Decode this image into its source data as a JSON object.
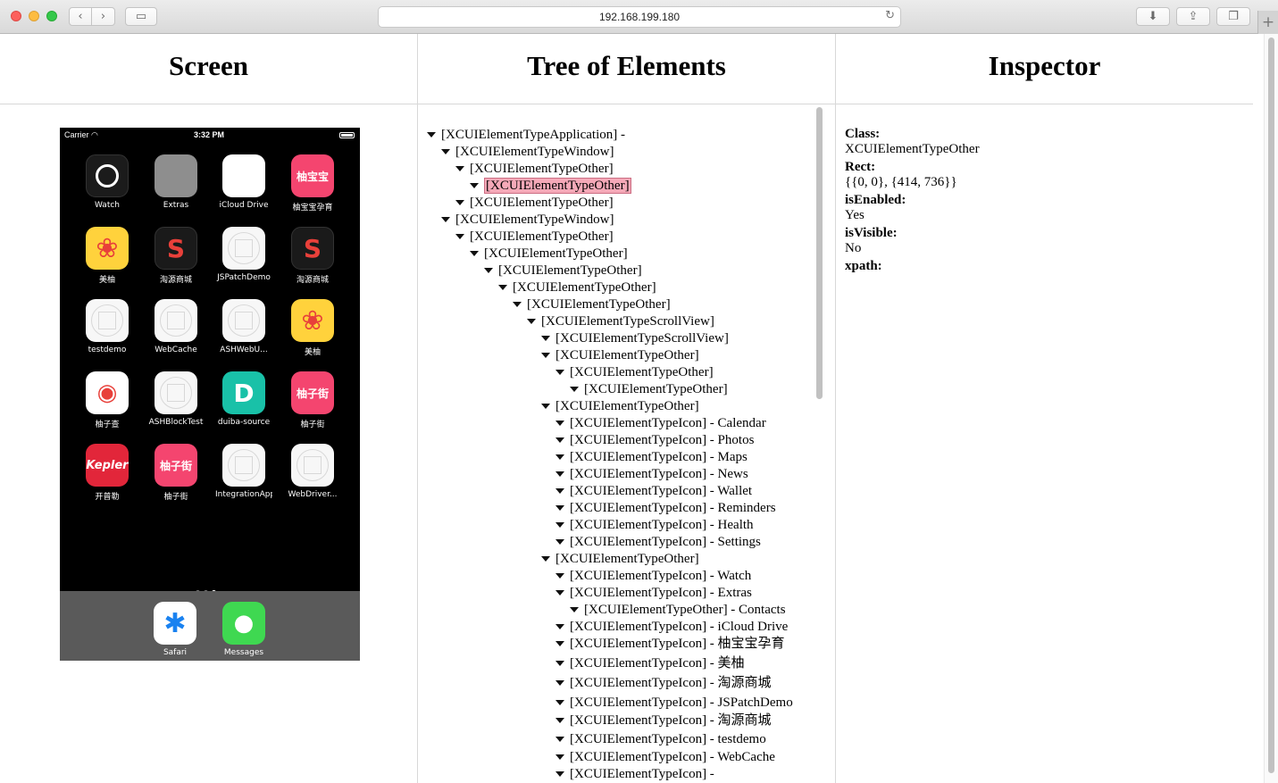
{
  "browser": {
    "url": "192.168.199.180",
    "back_icon": "chevron-left",
    "forward_icon": "chevron-right",
    "sidebar_icon": "sidebar",
    "reload_icon": "reload",
    "download_icon": "download",
    "share_icon": "share",
    "tabs_icon": "tabs",
    "new_tab_label": "+"
  },
  "columns": {
    "screen_title": "Screen",
    "tree_title": "Tree of Elements",
    "inspector_title": "Inspector"
  },
  "phone": {
    "carrier": "Carrier",
    "time": "3:32 PM",
    "page_dots": 3,
    "active_page": 3,
    "apps": [
      {
        "label": "Watch",
        "icon": "watch-icon"
      },
      {
        "label": "Extras",
        "icon": "folder-icon"
      },
      {
        "label": "iCloud Drive",
        "icon": "cloud-icon"
      },
      {
        "label": "柚宝宝孕育",
        "icon": "baby-icon",
        "glyph": "柚宝宝"
      },
      {
        "label": "美柚",
        "icon": "citrus-icon",
        "glyph": "❀"
      },
      {
        "label": "淘源商城",
        "icon": "taoyuan-icon",
        "glyph": "S"
      },
      {
        "label": "JSPatchDemo",
        "icon": "placeholder-icon"
      },
      {
        "label": "淘源商城",
        "icon": "taoyuan-icon",
        "glyph": "S"
      },
      {
        "label": "testdemo",
        "icon": "placeholder-icon"
      },
      {
        "label": "WebCache",
        "icon": "placeholder-icon"
      },
      {
        "label": "ASHWebU...",
        "icon": "placeholder-icon"
      },
      {
        "label": "美柚",
        "icon": "citrus-icon",
        "glyph": "❀"
      },
      {
        "label": "柚子查",
        "icon": "eye-icon",
        "glyph": "◉"
      },
      {
        "label": "ASHBlockTest",
        "icon": "placeholder-icon"
      },
      {
        "label": "duiba-source",
        "icon": "duiba-icon",
        "glyph": "D"
      },
      {
        "label": "柚子街",
        "icon": "youzijie-icon",
        "glyph": "柚子街"
      },
      {
        "label": "开普勒",
        "icon": "kepler-icon",
        "glyph": "Kepler"
      },
      {
        "label": "柚子街",
        "icon": "youzijie-icon",
        "glyph": "柚子街"
      },
      {
        "label": "IntegrationApp",
        "icon": "placeholder-icon"
      },
      {
        "label": "WebDriver...",
        "icon": "placeholder-icon"
      }
    ],
    "dock": [
      {
        "label": "Safari",
        "icon": "compass-icon",
        "glyph": "✱"
      },
      {
        "label": "Messages",
        "icon": "speech-bubble-icon",
        "glyph": "●"
      }
    ]
  },
  "tree": [
    {
      "depth": 0,
      "text": "[XCUIElementTypeApplication] -"
    },
    {
      "depth": 1,
      "text": "[XCUIElementTypeWindow]"
    },
    {
      "depth": 2,
      "text": "[XCUIElementTypeOther]"
    },
    {
      "depth": 3,
      "text": "[XCUIElementTypeOther]",
      "selected": true
    },
    {
      "depth": 2,
      "text": "[XCUIElementTypeOther]"
    },
    {
      "depth": 1,
      "text": "[XCUIElementTypeWindow]"
    },
    {
      "depth": 2,
      "text": "[XCUIElementTypeOther]"
    },
    {
      "depth": 3,
      "text": "[XCUIElementTypeOther]"
    },
    {
      "depth": 4,
      "text": "[XCUIElementTypeOther]"
    },
    {
      "depth": 5,
      "text": "[XCUIElementTypeOther]"
    },
    {
      "depth": 6,
      "text": "[XCUIElementTypeOther]"
    },
    {
      "depth": 7,
      "text": "[XCUIElementTypeScrollView]"
    },
    {
      "depth": 8,
      "text": "[XCUIElementTypeScrollView]"
    },
    {
      "depth": 8,
      "text": "[XCUIElementTypeOther]"
    },
    {
      "depth": 9,
      "text": "[XCUIElementTypeOther]"
    },
    {
      "depth": 10,
      "text": "[XCUIElementTypeOther]"
    },
    {
      "depth": 8,
      "text": "[XCUIElementTypeOther]"
    },
    {
      "depth": 9,
      "text": "[XCUIElementTypeIcon] - Calendar"
    },
    {
      "depth": 9,
      "text": "[XCUIElementTypeIcon] - Photos"
    },
    {
      "depth": 9,
      "text": "[XCUIElementTypeIcon] - Maps"
    },
    {
      "depth": 9,
      "text": "[XCUIElementTypeIcon] - News"
    },
    {
      "depth": 9,
      "text": "[XCUIElementTypeIcon] - Wallet"
    },
    {
      "depth": 9,
      "text": "[XCUIElementTypeIcon] - Reminders"
    },
    {
      "depth": 9,
      "text": "[XCUIElementTypeIcon] - Health"
    },
    {
      "depth": 9,
      "text": "[XCUIElementTypeIcon] - Settings"
    },
    {
      "depth": 8,
      "text": "[XCUIElementTypeOther]"
    },
    {
      "depth": 9,
      "text": "[XCUIElementTypeIcon] - Watch"
    },
    {
      "depth": 9,
      "text": "[XCUIElementTypeIcon] - Extras"
    },
    {
      "depth": 10,
      "text": "[XCUIElementTypeOther] - Contacts"
    },
    {
      "depth": 9,
      "text": "[XCUIElementTypeIcon] - iCloud Drive"
    },
    {
      "depth": 9,
      "text": "[XCUIElementTypeIcon] - 柚宝宝孕育"
    },
    {
      "depth": 9,
      "text": "[XCUIElementTypeIcon] - 美柚"
    },
    {
      "depth": 9,
      "text": "[XCUIElementTypeIcon] - 淘源商城"
    },
    {
      "depth": 9,
      "text": "[XCUIElementTypeIcon] - JSPatchDemo"
    },
    {
      "depth": 9,
      "text": "[XCUIElementTypeIcon] - 淘源商城"
    },
    {
      "depth": 9,
      "text": "[XCUIElementTypeIcon] - testdemo"
    },
    {
      "depth": 9,
      "text": "[XCUIElementTypeIcon] - WebCache"
    },
    {
      "depth": 9,
      "text": "[XCUIElementTypeIcon] -"
    }
  ],
  "inspector": {
    "class_label": "Class:",
    "class_value": "XCUIElementTypeOther",
    "rect_label": "Rect:",
    "rect_value": "{{0, 0}, {414, 736}}",
    "enabled_label": "isEnabled:",
    "enabled_value": "Yes",
    "visible_label": "isVisible:",
    "visible_value": "No",
    "xpath_label": "xpath:"
  }
}
